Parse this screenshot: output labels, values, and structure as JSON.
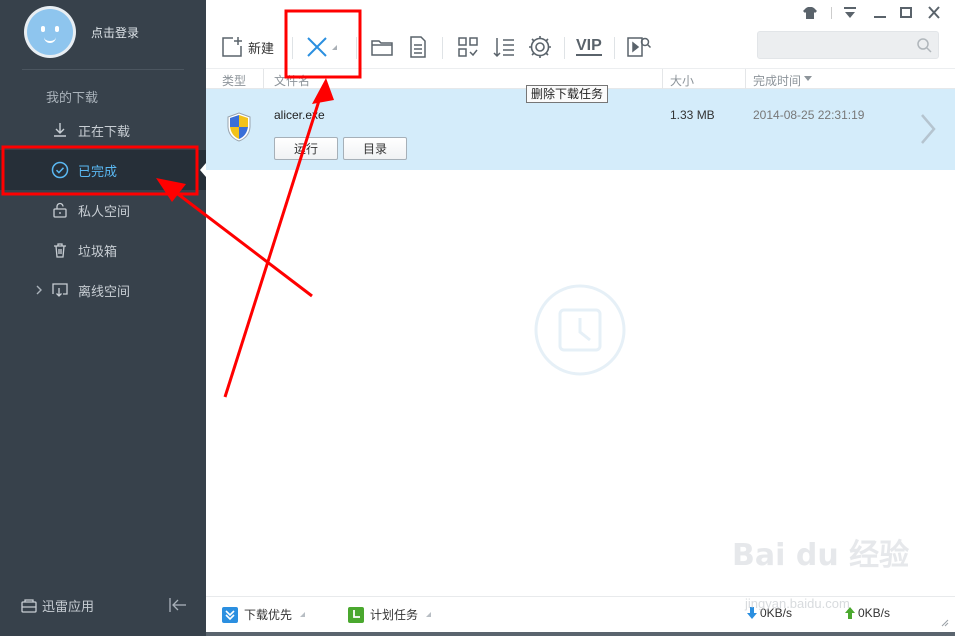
{
  "user": {
    "login_label": "点击登录"
  },
  "sidebar": {
    "section_title": "我的下载",
    "items": [
      {
        "label": "正在下载",
        "icon": "download-icon"
      },
      {
        "label": "已完成",
        "icon": "check-circle-icon",
        "active": true
      },
      {
        "label": "私人空间",
        "icon": "unlock-icon"
      },
      {
        "label": "垃圾箱",
        "icon": "trash-icon"
      },
      {
        "label": "离线空间",
        "icon": "cloud-download-icon",
        "expandable": true
      }
    ],
    "apps_label": "迅雷应用"
  },
  "toolbar": {
    "new_label": "新建",
    "vip_label": "VIP",
    "tooltip": "删除下载任务"
  },
  "columns": {
    "type": "类型",
    "name": "文件名",
    "size": "大小",
    "completed_time": "完成时间"
  },
  "task": {
    "name": "alicer.exe",
    "size": "1.33 MB",
    "time": "2014-08-25 22:31:19",
    "run_label": "运行",
    "dir_label": "目录"
  },
  "status": {
    "download_priority": "下载优先",
    "scheduled_task": "计划任务",
    "down_speed": "0KB/s",
    "up_speed": "0KB/s"
  },
  "watermark": {
    "brand": "Bai du 经验",
    "url": "jingyan.baidu.com"
  },
  "colors": {
    "accent": "#2b8fe0",
    "annotation": "#ff0000",
    "sidebar": "#37414b",
    "selected_row": "#d4ecfa"
  }
}
